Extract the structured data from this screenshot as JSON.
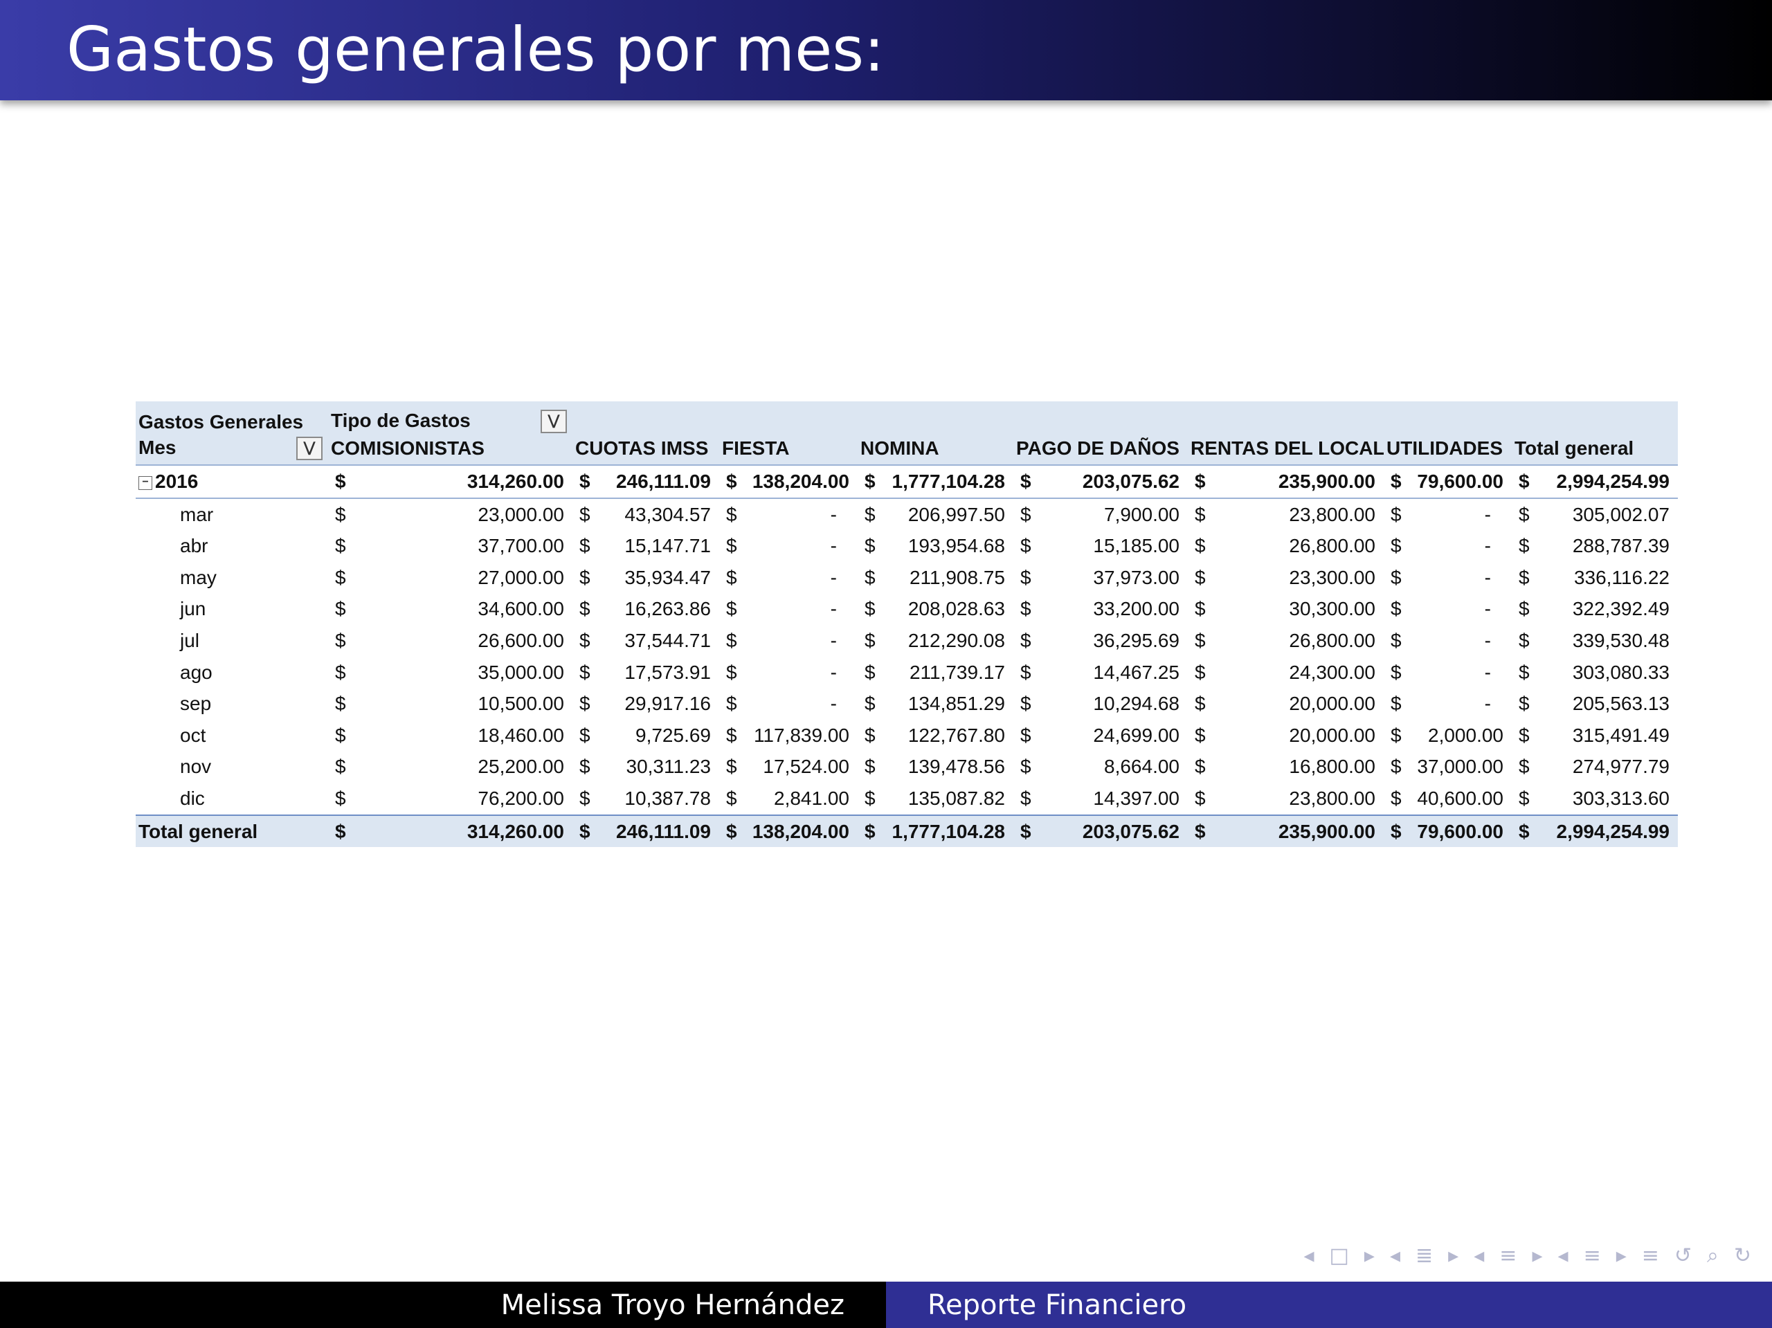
{
  "title": "Gastos generales por mes:",
  "pivot": {
    "header_row1": {
      "values_label": "Gastos Generales",
      "columns_label": "Tipo de Gastos"
    },
    "header_row2": {
      "rows_label": "Mes",
      "columns": [
        "COMISIONISTAS",
        "CUOTAS IMSS",
        "FIESTA",
        "NOMINA",
        "PAGO DE DAÑOS",
        "RENTAS DEL LOCAL",
        "UTILIDADES",
        "Total general"
      ]
    },
    "currency": "$",
    "dash": "-",
    "year_row": {
      "label": "2016",
      "values": [
        "314,260.00",
        "246,111.09",
        "138,204.00",
        "1,777,104.28",
        "203,075.62",
        "235,900.00",
        "79,600.00",
        "2,994,254.99"
      ]
    },
    "months": [
      {
        "label": "mar",
        "values": [
          "23,000.00",
          "43,304.57",
          "-",
          "206,997.50",
          "7,900.00",
          "23,800.00",
          "-",
          "305,002.07"
        ]
      },
      {
        "label": "abr",
        "values": [
          "37,700.00",
          "15,147.71",
          "-",
          "193,954.68",
          "15,185.00",
          "26,800.00",
          "-",
          "288,787.39"
        ]
      },
      {
        "label": "may",
        "values": [
          "27,000.00",
          "35,934.47",
          "-",
          "211,908.75",
          "37,973.00",
          "23,300.00",
          "-",
          "336,116.22"
        ]
      },
      {
        "label": "jun",
        "values": [
          "34,600.00",
          "16,263.86",
          "-",
          "208,028.63",
          "33,200.00",
          "30,300.00",
          "-",
          "322,392.49"
        ]
      },
      {
        "label": "jul",
        "values": [
          "26,600.00",
          "37,544.71",
          "-",
          "212,290.08",
          "36,295.69",
          "26,800.00",
          "-",
          "339,530.48"
        ]
      },
      {
        "label": "ago",
        "values": [
          "35,000.00",
          "17,573.91",
          "-",
          "211,739.17",
          "14,467.25",
          "24,300.00",
          "-",
          "303,080.33"
        ]
      },
      {
        "label": "sep",
        "values": [
          "10,500.00",
          "29,917.16",
          "-",
          "134,851.29",
          "10,294.68",
          "20,000.00",
          "-",
          "205,563.13"
        ]
      },
      {
        "label": "oct",
        "values": [
          "18,460.00",
          "9,725.69",
          "117,839.00",
          "122,767.80",
          "24,699.00",
          "20,000.00",
          "2,000.00",
          "315,491.49"
        ]
      },
      {
        "label": "nov",
        "values": [
          "25,200.00",
          "30,311.23",
          "17,524.00",
          "139,478.56",
          "8,664.00",
          "16,800.00",
          "37,000.00",
          "274,977.79"
        ]
      },
      {
        "label": "dic",
        "values": [
          "76,200.00",
          "10,387.78",
          "2,841.00",
          "135,087.82",
          "14,397.00",
          "23,800.00",
          "40,600.00",
          "303,313.60"
        ]
      }
    ],
    "total_row": {
      "label": "Total general",
      "values": [
        "314,260.00",
        "246,111.09",
        "138,204.00",
        "1,777,104.28",
        "203,075.62",
        "235,900.00",
        "79,600.00",
        "2,994,254.99"
      ]
    }
  },
  "nav_icons": [
    "nav-left-arrow",
    "frame-icon",
    "nav-right-arrow",
    "nav-left-arrow",
    "subsection-icon",
    "nav-right-arrow",
    "nav-left-arrow",
    "section-icon",
    "nav-right-arrow",
    "nav-left-arrow",
    "section-icon",
    "nav-right-arrow",
    "align-icon",
    "undo-icon",
    "search-icon",
    "redo-icon"
  ],
  "footer": {
    "author": "Melissa Troyo Hernández",
    "short_title": "Reporte Financiero"
  }
}
